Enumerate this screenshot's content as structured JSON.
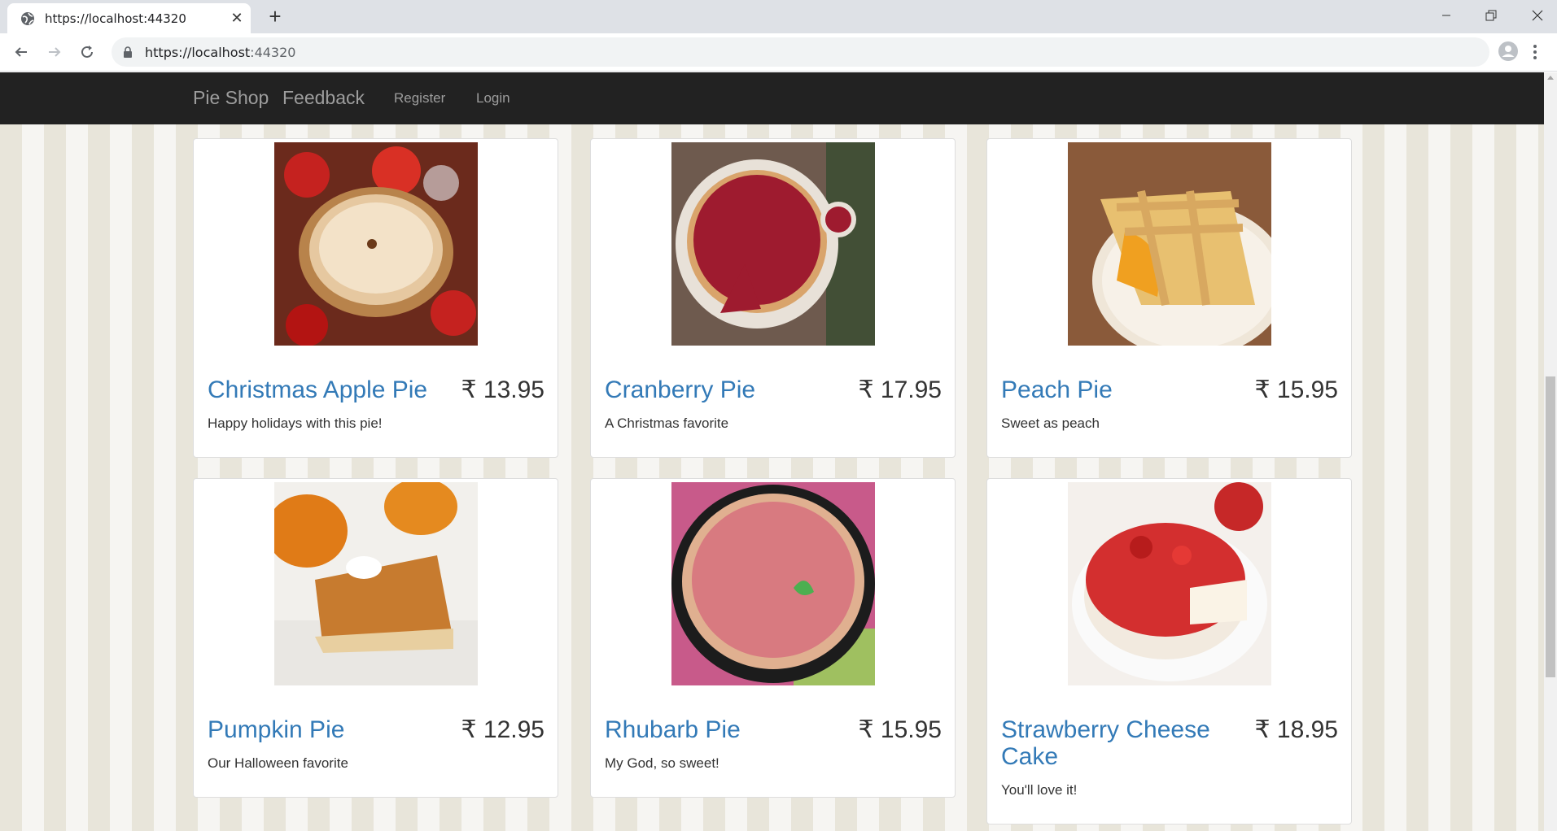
{
  "browser": {
    "tab_title": "https://localhost:44320",
    "url_host": "https://localhost",
    "url_port": ":44320"
  },
  "site": {
    "brand": "Pie Shop",
    "feedback": "Feedback",
    "register": "Register",
    "login": "Login"
  },
  "currency": "₹",
  "pies": [
    {
      "name": "Christmas Apple Pie",
      "price": "₹ 13.95",
      "description": "Happy holidays with this pie!"
    },
    {
      "name": "Cranberry Pie",
      "price": "₹ 17.95",
      "description": "A Christmas favorite"
    },
    {
      "name": "Peach Pie",
      "price": "₹ 15.95",
      "description": "Sweet as peach"
    },
    {
      "name": "Pumpkin Pie",
      "price": "₹ 12.95",
      "description": "Our Halloween favorite"
    },
    {
      "name": "Rhubarb Pie",
      "price": "₹ 15.95",
      "description": "My God, so sweet!"
    },
    {
      "name": "Strawberry Cheese Cake",
      "price": "₹ 18.95",
      "description": "You'll love it!"
    }
  ],
  "colors": {
    "nav_bg": "#222222",
    "link": "#337ab7",
    "stripe_dark": "#e8e5da",
    "stripe_light": "#f6f5f2"
  }
}
